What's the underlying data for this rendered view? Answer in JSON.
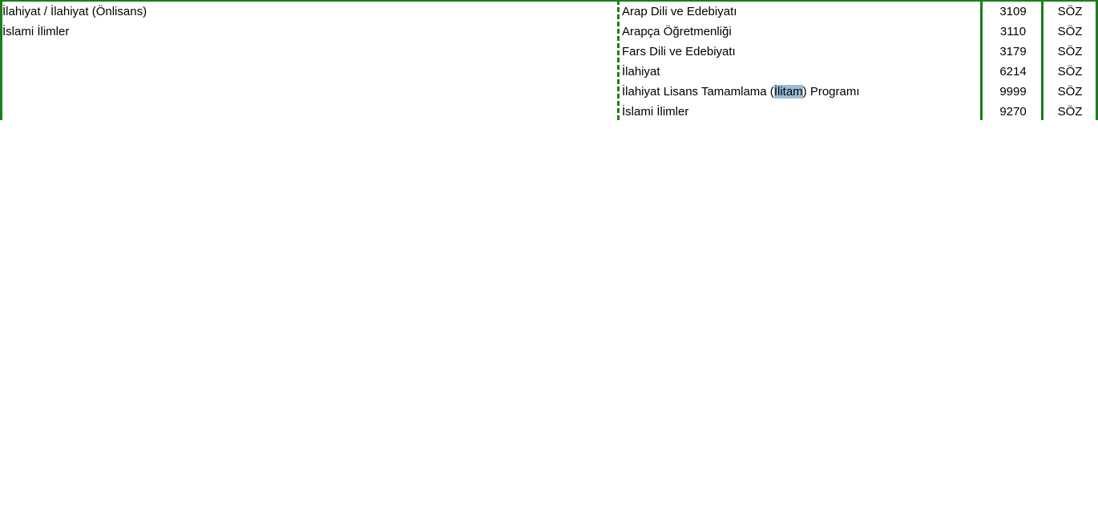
{
  "sheet": {
    "left_cells": [
      "İlahiyat / İlahiyat (Önlisans)",
      "İslami İlimler"
    ],
    "rows": [
      {
        "program_pre": "Arap Dili ve Edebiyatı",
        "program_hl": "",
        "program_post": "",
        "code": "3109",
        "score_type": "SÖZ"
      },
      {
        "program_pre": "Arapça Öğretmenliği",
        "program_hl": "",
        "program_post": "",
        "code": "3110",
        "score_type": "SÖZ"
      },
      {
        "program_pre": "Fars Dili ve Edebiyatı",
        "program_hl": "",
        "program_post": "",
        "code": "3179",
        "score_type": "SÖZ"
      },
      {
        "program_pre": "İlahiyat",
        "program_hl": "",
        "program_post": "",
        "code": "6214",
        "score_type": "SÖZ"
      },
      {
        "program_pre": "İlahiyat Lisans Tamamlama (",
        "program_hl": "İlitam",
        "program_post": ") Programı",
        "code": "9999",
        "score_type": "SÖZ"
      },
      {
        "program_pre": "İslami İlimler",
        "program_hl": "",
        "program_post": "",
        "code": "9270",
        "score_type": "SÖZ"
      }
    ]
  },
  "colors": {
    "border": "#1a7f1a",
    "highlight": "#9bbcd6"
  }
}
